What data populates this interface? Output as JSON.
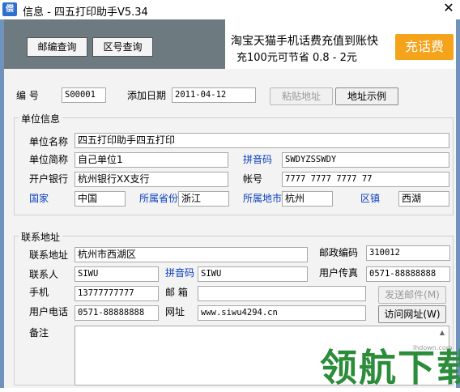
{
  "window": {
    "title": "信息 - 四五打印助手V5.34",
    "app_icon_text": "偿",
    "close_glyph": "✕"
  },
  "toolbar": {
    "zip_query": "邮编查询",
    "area_code_query": "区号查询"
  },
  "ad": {
    "line1": "淘宝天猫手机话费充值到账快",
    "line2": "充100元可节省 0.8 - 2元",
    "button": "充话费"
  },
  "header": {
    "code_label": "编   号",
    "code_value": "S00001",
    "date_label": "添加日期",
    "date_value": "2011-04-12",
    "paste_address": "粘贴地址",
    "address_example": "地址示例"
  },
  "unit": {
    "group_title": "单位信息",
    "name_label": "单位名称",
    "name_value": "四五打印助手四五打印",
    "short_label": "单位简称",
    "short_value": "自己单位1",
    "pinyin_label": "拼音码",
    "pinyin_value": "SWDYZSSWDY",
    "bank_label": "开户银行",
    "bank_value": "杭州银行XX支行",
    "account_label": "帐号",
    "account_value": "7777 7777 7777 77",
    "country_label": "国家",
    "country_value": "中国",
    "province_label": "所属省份",
    "province_value": "浙江",
    "city_label": "所属地市",
    "city_value": "杭州",
    "district_label": "区镇",
    "district_value": "西湖"
  },
  "contact": {
    "group_title": "联系地址",
    "address_label": "联系地址",
    "address_value": "杭州市西湖区",
    "postcode_label": "邮政编码",
    "postcode_value": "310012",
    "person_label": "联系人",
    "person_value": "SIWU",
    "pinyin_label": "拼音码",
    "pinyin_value": "SIWU",
    "fax_label": "用户传真",
    "fax_value": "0571-88888888",
    "mobile_label": "手机",
    "mobile_value": "13777777777",
    "email_label": "邮   箱",
    "email_value": "",
    "send_mail": "发送邮件(M)",
    "phone_label": "用户电话",
    "phone_value": "0571-88888888",
    "website_label": "网址",
    "website_value": "www.siwu4294.cn",
    "visit_site": "访问网址(W)",
    "remark_label": "备注",
    "remark_value": ""
  },
  "watermark": {
    "text": "领航下载",
    "small": "lhdown.com"
  },
  "colors": {
    "toolbar_bg": "#6d7a80",
    "ad_button": "#f5a31a",
    "blue_label": "#0a3fc0",
    "watermark": "#2b8c3a"
  }
}
